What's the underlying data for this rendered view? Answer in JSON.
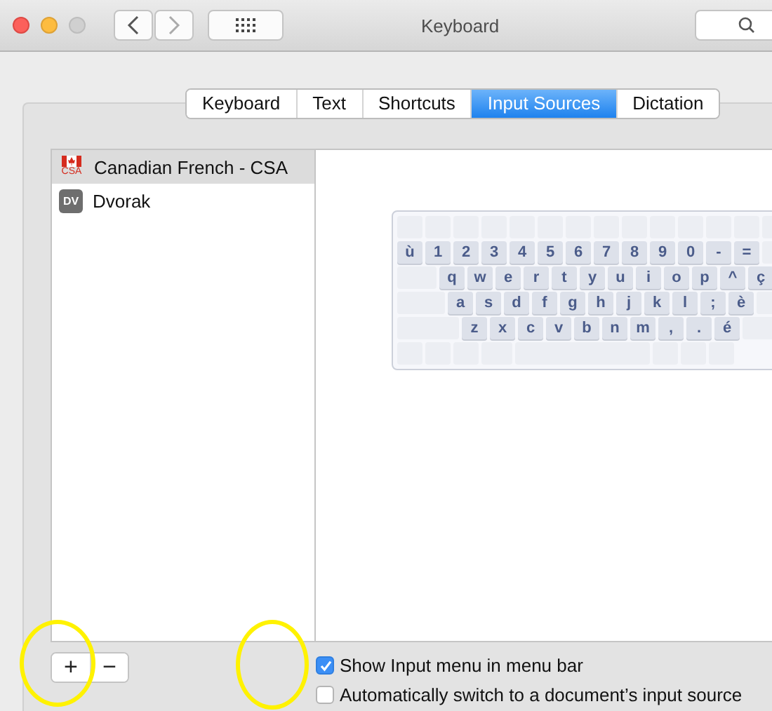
{
  "window": {
    "title": "Keyboard"
  },
  "tabs": [
    {
      "label": "Keyboard",
      "selected": false
    },
    {
      "label": "Text",
      "selected": false
    },
    {
      "label": "Shortcuts",
      "selected": false
    },
    {
      "label": "Input Sources",
      "selected": true
    },
    {
      "label": "Dictation",
      "selected": false
    }
  ],
  "sources": [
    {
      "name": "Canadian French - CSA",
      "kind": "flag",
      "icon_text": "CSA",
      "selected": true
    },
    {
      "name": "Dvorak",
      "kind": "badge",
      "icon_text": "DV",
      "selected": false
    }
  ],
  "keyboard_rows": [
    [
      "ù",
      "1",
      "2",
      "3",
      "4",
      "5",
      "6",
      "7",
      "8",
      "9",
      "0",
      "-",
      "="
    ],
    [
      "q",
      "w",
      "e",
      "r",
      "t",
      "y",
      "u",
      "i",
      "o",
      "p",
      "^",
      "ç"
    ],
    [
      "a",
      "s",
      "d",
      "f",
      "g",
      "h",
      "j",
      "k",
      "l",
      ";",
      "è"
    ],
    [
      "z",
      "x",
      "c",
      "v",
      "b",
      "n",
      "m",
      ",",
      ".",
      "é"
    ]
  ],
  "list_buttons": [
    {
      "label": "+"
    },
    {
      "label": "−"
    }
  ],
  "options": [
    {
      "label": "Show Input menu in menu bar",
      "checked": true
    },
    {
      "label": "Automatically switch to a document’s input source",
      "checked": false
    }
  ]
}
